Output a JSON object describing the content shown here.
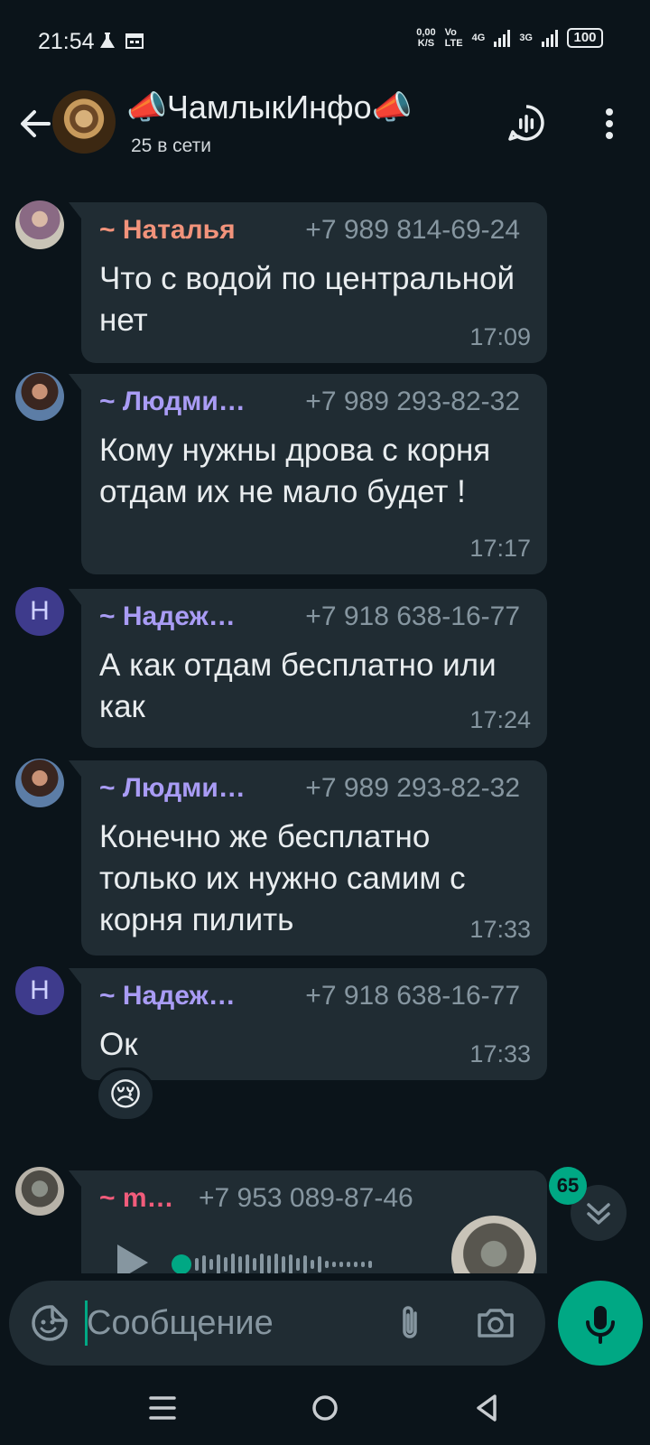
{
  "status_bar": {
    "time": "21:54",
    "net_speed_value": "0,00",
    "net_speed_unit": "K/S",
    "volte_top": "Vo",
    "volte_bottom": "LTE",
    "signal1": "4G",
    "signal2": "3G",
    "battery": "100"
  },
  "header": {
    "title": "📣ЧамлыкИнфо📣",
    "subtitle": "25 в сети",
    "icons": [
      "back-arrow-icon",
      "voice-chat-icon",
      "more-vertical-icon"
    ]
  },
  "messages": [
    {
      "sender": "~ Наталья",
      "sender_color": "#f2937b",
      "phone": "+7 989 814-69-24",
      "text": "Что с водой по центральной  нет",
      "time": "17:09",
      "avatar": "photo"
    },
    {
      "sender": "~ Людми…",
      "sender_color": "#a99cf5",
      "phone": "+7 989 293-82-32",
      "text": "Кому нужны дрова с корня отдам их не мало будет !",
      "time": "17:17",
      "avatar": "photo"
    },
    {
      "sender": "~ Надеж…",
      "sender_color": "#a99cf5",
      "phone": "+7 918 638-16-77",
      "text": "А как  отдам бесплатно или как",
      "time": "17:24",
      "avatar_letter": "Н"
    },
    {
      "sender": "~ Людми…",
      "sender_color": "#a99cf5",
      "phone": "+7 989 293-82-32",
      "text": "Конечно же бесплатно только их нужно самим с корня пилить",
      "time": "17:33",
      "avatar": "photo"
    },
    {
      "sender": "~ Надеж…",
      "sender_color": "#a99cf5",
      "phone": "+7 918 638-16-77",
      "text": "Ок",
      "time": "17:33",
      "avatar_letter": "Н",
      "reaction": "😢"
    },
    {
      "sender": "~ m…",
      "sender_color": "#f25c7b",
      "phone": "+7 953 089-87-46",
      "type": "voice",
      "avatar": "photo"
    }
  ],
  "unread_count": "65",
  "composer": {
    "placeholder": "Сообщение",
    "icons": [
      "sticker-icon",
      "attach-icon",
      "camera-icon",
      "mic-icon"
    ]
  },
  "accent": "#00a884"
}
